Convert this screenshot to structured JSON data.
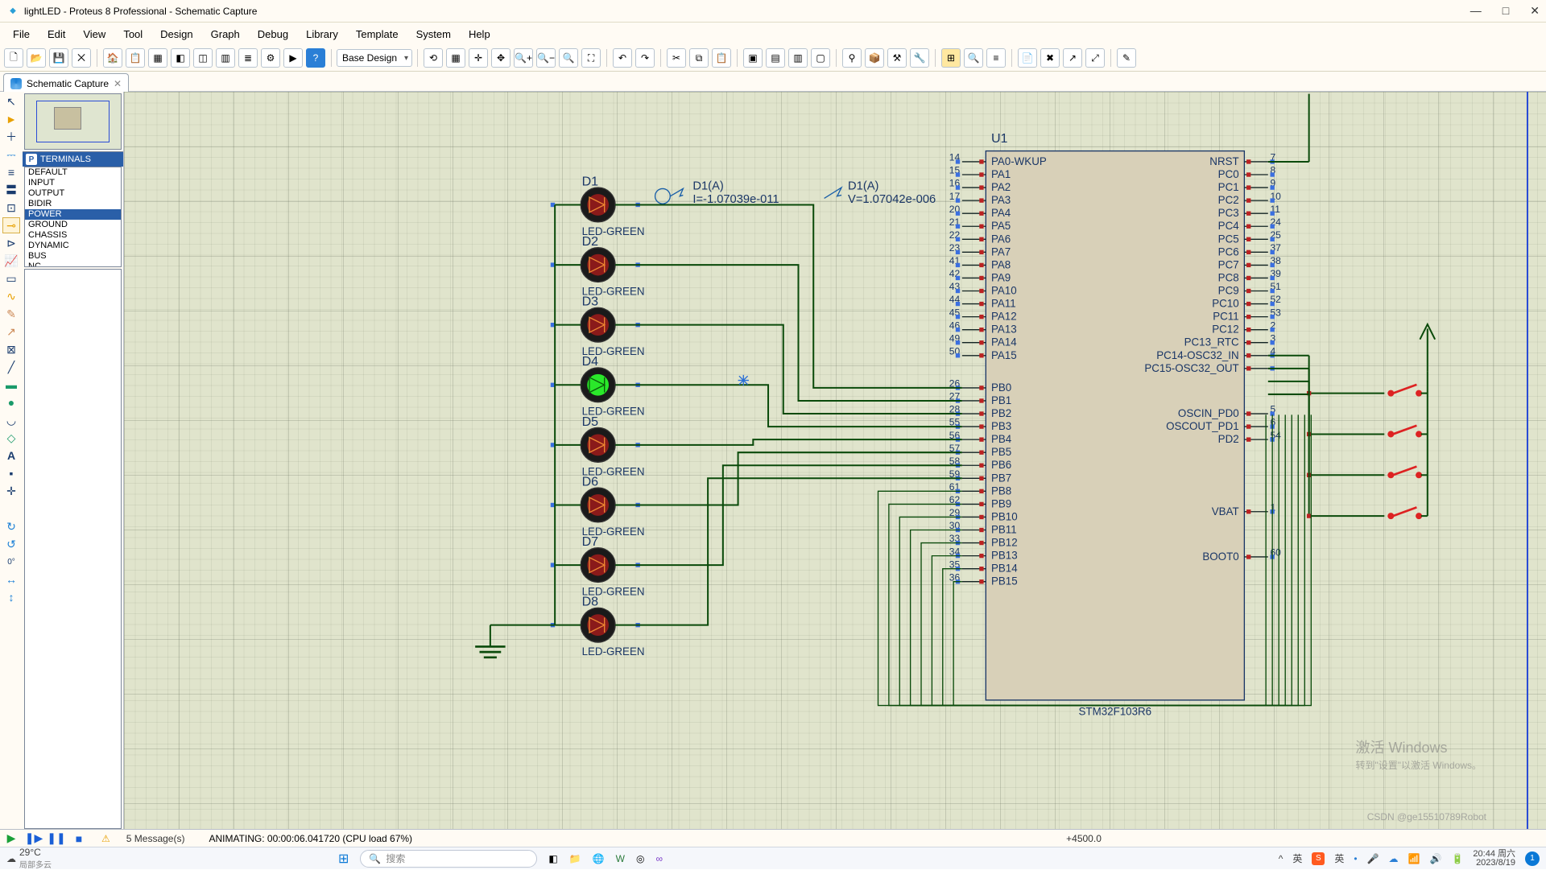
{
  "window": {
    "title": "lightLED - Proteus 8 Professional - Schematic Capture"
  },
  "menu": [
    "File",
    "Edit",
    "View",
    "Tool",
    "Design",
    "Graph",
    "Debug",
    "Library",
    "Template",
    "System",
    "Help"
  ],
  "toolbar": {
    "design_combo": "Base Design"
  },
  "tab": {
    "label": "Schematic Capture"
  },
  "terminals": {
    "header": "TERMINALS",
    "items": [
      "DEFAULT",
      "INPUT",
      "OUTPUT",
      "BIDIR",
      "POWER",
      "GROUND",
      "CHASSIS",
      "DYNAMIC",
      "BUS",
      "NC"
    ],
    "selected": "POWER"
  },
  "rot_label": "0°",
  "status": {
    "messages": "5 Message(s)",
    "anim": "ANIMATING: 00:00:06.041720 (CPU load 67%)",
    "coords": "+4500.0"
  },
  "watermark": {
    "line1": "激活 Windows",
    "line2": "转到\"设置\"以激活 Windows。"
  },
  "csdn": "CSDN @ge15510789Robot",
  "taskbar": {
    "temp": "29°C",
    "weather": "局部多云",
    "search_ph": "搜索",
    "ime": "英",
    "time": "20:44 周六",
    "date": "2023/8/19",
    "notif": "1"
  },
  "schematic": {
    "u1": {
      "ref": "U1",
      "value": "STM32F103R6",
      "left_pins": [
        {
          "num": "14",
          "name": "PA0-WKUP"
        },
        {
          "num": "15",
          "name": "PA1"
        },
        {
          "num": "16",
          "name": "PA2"
        },
        {
          "num": "17",
          "name": "PA3"
        },
        {
          "num": "20",
          "name": "PA4"
        },
        {
          "num": "21",
          "name": "PA5"
        },
        {
          "num": "22",
          "name": "PA6"
        },
        {
          "num": "23",
          "name": "PA7"
        },
        {
          "num": "41",
          "name": "PA8"
        },
        {
          "num": "42",
          "name": "PA9"
        },
        {
          "num": "43",
          "name": "PA10"
        },
        {
          "num": "44",
          "name": "PA11"
        },
        {
          "num": "45",
          "name": "PA12"
        },
        {
          "num": "46",
          "name": "PA13"
        },
        {
          "num": "49",
          "name": "PA14"
        },
        {
          "num": "50",
          "name": "PA15"
        },
        {
          "num": "26",
          "name": "PB0"
        },
        {
          "num": "27",
          "name": "PB1"
        },
        {
          "num": "28",
          "name": "PB2"
        },
        {
          "num": "55",
          "name": "PB3"
        },
        {
          "num": "56",
          "name": "PB4"
        },
        {
          "num": "57",
          "name": "PB5"
        },
        {
          "num": "58",
          "name": "PB6"
        },
        {
          "num": "59",
          "name": "PB7"
        },
        {
          "num": "61",
          "name": "PB8"
        },
        {
          "num": "62",
          "name": "PB9"
        },
        {
          "num": "29",
          "name": "PB10"
        },
        {
          "num": "30",
          "name": "PB11"
        },
        {
          "num": "33",
          "name": "PB12"
        },
        {
          "num": "34",
          "name": "PB13"
        },
        {
          "num": "35",
          "name": "PB14"
        },
        {
          "num": "36",
          "name": "PB15"
        }
      ],
      "right_pins": [
        {
          "num": "7",
          "name": "NRST"
        },
        {
          "num": "8",
          "name": "PC0"
        },
        {
          "num": "9",
          "name": "PC1"
        },
        {
          "num": "10",
          "name": "PC2"
        },
        {
          "num": "11",
          "name": "PC3"
        },
        {
          "num": "24",
          "name": "PC4"
        },
        {
          "num": "25",
          "name": "PC5"
        },
        {
          "num": "37",
          "name": "PC6"
        },
        {
          "num": "38",
          "name": "PC7"
        },
        {
          "num": "39",
          "name": "PC8"
        },
        {
          "num": "51",
          "name": "PC9"
        },
        {
          "num": "52",
          "name": "PC10"
        },
        {
          "num": "53",
          "name": "PC11"
        },
        {
          "num": "2",
          "name": "PC12"
        },
        {
          "num": "3",
          "name": "PC13_RTC"
        },
        {
          "num": "4",
          "name": "PC14-OSC32_IN"
        },
        {
          "num": "",
          "name": "PC15-OSC32_OUT"
        },
        {
          "num": "5",
          "name": "OSCIN_PD0"
        },
        {
          "num": "6",
          "name": "OSCOUT_PD1"
        },
        {
          "num": "54",
          "name": "PD2"
        },
        {
          "num": "1",
          "name": "VBAT"
        },
        {
          "num": "60",
          "name": "BOOT0"
        }
      ]
    },
    "leds": [
      {
        "ref": "D1",
        "value": "LED-GREEN",
        "on": false
      },
      {
        "ref": "D2",
        "value": "LED-GREEN",
        "on": false
      },
      {
        "ref": "D3",
        "value": "LED-GREEN",
        "on": false
      },
      {
        "ref": "D4",
        "value": "LED-GREEN",
        "on": true
      },
      {
        "ref": "D5",
        "value": "LED-GREEN",
        "on": false
      },
      {
        "ref": "D6",
        "value": "LED-GREEN",
        "on": false
      },
      {
        "ref": "D7",
        "value": "LED-GREEN",
        "on": false
      },
      {
        "ref": "D8",
        "value": "LED-GREEN",
        "on": false
      }
    ],
    "probes": [
      {
        "name": "D1(A)",
        "val": "I=-1.07039e-011"
      },
      {
        "name": "D1(A)",
        "val": "V=1.07042e-006"
      }
    ]
  }
}
